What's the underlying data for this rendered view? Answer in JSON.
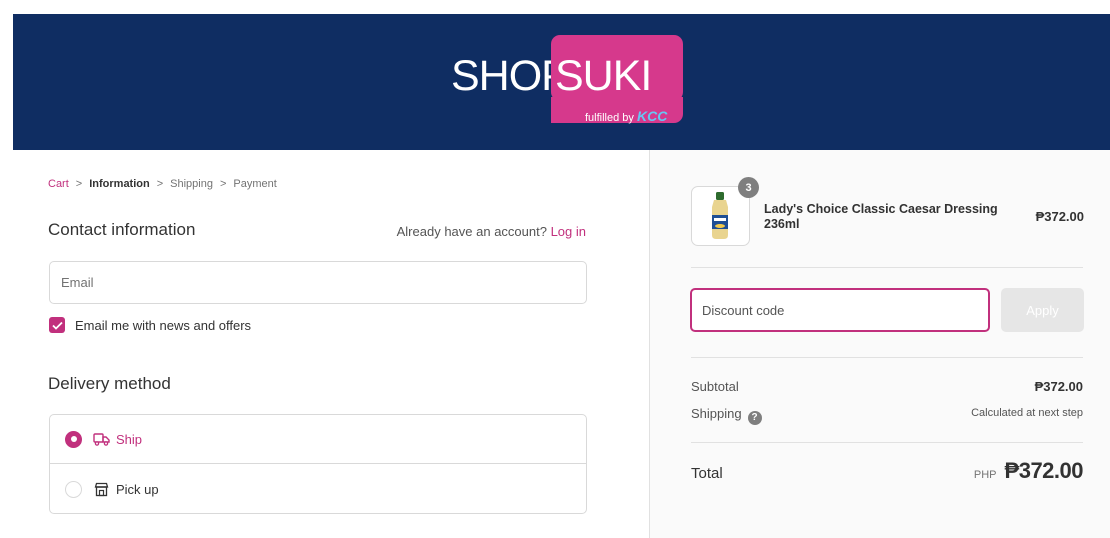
{
  "brand": {
    "logo_left": "SHOP",
    "logo_right": "SUKI",
    "fulfilled_by": "fulfilled by",
    "partner": "KCC",
    "header_color": "#0f2d62",
    "accent_color": "#c1307d"
  },
  "breadcrumb": [
    {
      "label": "Cart",
      "state": "link"
    },
    {
      "label": "Information",
      "state": "current"
    },
    {
      "label": "Shipping",
      "state": "upcoming"
    },
    {
      "label": "Payment",
      "state": "upcoming"
    }
  ],
  "contact": {
    "title": "Contact information",
    "account_prompt": "Already have an account?",
    "login_label": "Log in",
    "email_placeholder": "Email",
    "email_value": "",
    "newsletter_label": "Email me with news and offers",
    "newsletter_checked": true
  },
  "delivery": {
    "title": "Delivery method",
    "options": [
      {
        "label": "Ship",
        "icon": "truck-icon",
        "selected": true
      },
      {
        "label": "Pick up",
        "icon": "store-icon",
        "selected": false
      }
    ]
  },
  "order_summary": {
    "item": {
      "name": "Lady's Choice Classic Caesar Dressing 236ml",
      "quantity": "3",
      "price": "₱372.00"
    },
    "discount": {
      "placeholder": "Discount code",
      "value": "",
      "apply_label": "Apply"
    },
    "subtotal_label": "Subtotal",
    "subtotal_value": "₱372.00",
    "shipping_label": "Shipping",
    "shipping_value": "Calculated at next step",
    "total_label": "Total",
    "total_currency": "PHP",
    "total_value": "₱372.00"
  }
}
